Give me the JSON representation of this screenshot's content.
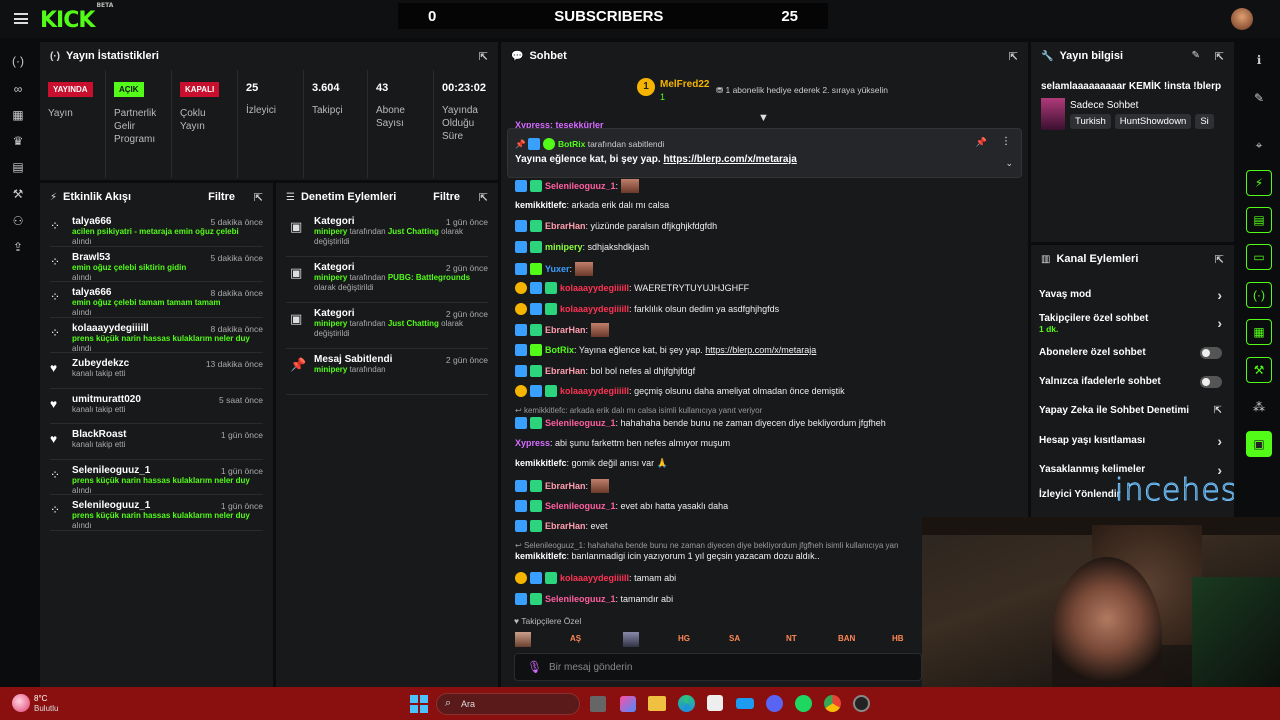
{
  "header": {
    "logo": "KICK",
    "beta": "BETA",
    "subs_left": "0",
    "subs_title": "SUBSCRIBERS",
    "subs_right": "25"
  },
  "stats": {
    "title": "Yayın İstatistikleri",
    "cols": [
      {
        "badge": "YAYINDA",
        "badge_color": "#c8102e",
        "label": "Yayın"
      },
      {
        "badge": "AÇIK",
        "badge_color": "#53fc18",
        "label": "Partnerlik Gelir Programı"
      },
      {
        "badge": "KAPALI",
        "badge_color": "#c8102e",
        "label": "Çoklu Yayın"
      },
      {
        "value": "25",
        "label": "İzleyici"
      },
      {
        "value": "3.604",
        "label": "Takipçi"
      },
      {
        "value": "43",
        "label": "Abone Sayısı"
      },
      {
        "value": "00:23:02",
        "label": "Yayında Olduğu Süre"
      }
    ]
  },
  "activity": {
    "title": "Etkinlik Akışı",
    "filter": "Filtre",
    "items": [
      {
        "icon": "gift-icon",
        "name": "talya666",
        "time": "5 dakika önce",
        "msg": "acilen psikiyatri - metaraja emin oğuz çelebi",
        "sub": "alındı"
      },
      {
        "icon": "gift-icon",
        "name": "Brawl53",
        "time": "5 dakika önce",
        "msg": "emin oğuz çelebi siktirin gidin",
        "sub": "alındı"
      },
      {
        "icon": "gift-icon",
        "name": "talya666",
        "time": "8 dakika önce",
        "msg": "emin oğuz çelebi tamam tamam tamam",
        "sub": "alındı"
      },
      {
        "icon": "gift-icon",
        "name": "kolaaayydegiiiill",
        "time": "8 dakika önce",
        "msg": "prens küçük narin hassas kulaklarım neler duy",
        "sub": "alındı"
      },
      {
        "icon": "heart-icon",
        "name": "Zubeydekzc",
        "time": "13 dakika önce",
        "msg": "",
        "sub": "kanalı takip etti"
      },
      {
        "icon": "heart-icon",
        "name": "umitmuratt020",
        "time": "5 saat önce",
        "msg": "",
        "sub": "kanalı takip etti"
      },
      {
        "icon": "heart-icon",
        "name": "BlackRoast",
        "time": "1 gün önce",
        "msg": "",
        "sub": "kanalı takip etti"
      },
      {
        "icon": "gift-icon",
        "name": "Selenileoguuz_1",
        "time": "1 gün önce",
        "msg": "prens küçük narin hassas kulaklarım neler duy",
        "sub": "alındı"
      },
      {
        "icon": "gift-icon",
        "name": "Selenileoguuz_1",
        "time": "1 gün önce",
        "msg": "prens küçük narin hassas kulaklarım neler duy",
        "sub": "alındı"
      }
    ]
  },
  "moderation": {
    "title": "Denetim Eylemleri",
    "filter": "Filtre",
    "items": [
      {
        "name": "Kategori",
        "time": "1 gün önce",
        "user": "minipery",
        "pre": " tarafından ",
        "val": "Just Chatting",
        "post": " olarak değiştirildi"
      },
      {
        "name": "Kategori",
        "time": "2 gün önce",
        "user": "minipery",
        "pre": " tarafından ",
        "val": "PUBG: Battlegrounds",
        "post": " olarak değiştirildi"
      },
      {
        "name": "Kategori",
        "time": "2 gün önce",
        "user": "minipery",
        "pre": " tarafından ",
        "val": "Just Chatting",
        "post": " olarak değiştirildi"
      },
      {
        "name": "Mesaj Sabitlendi",
        "time": "2 gün önce",
        "user": "minipery",
        "pre": " tarafından",
        "val": "",
        "post": ""
      }
    ]
  },
  "chat": {
    "title": "Sohbet",
    "gifter": "MelFred22",
    "gifter_count": "1",
    "gift_text": "1 abonelik hediye ederek 2. sıraya yükselin",
    "pinned_by": "BotRix",
    "pinned_suffix": "tarafından sabitlendi",
    "pinned_text": "Yayına eğlence kat, bi şey yap.",
    "pinned_link": "https://blerp.com/x/metaraja",
    "cut_top": "Xypress: teşekkürler",
    "messages": [
      {
        "user": "Selenileoguuz_1",
        "color": "#ff5fa2",
        "text": "",
        "emote": true
      },
      {
        "user": "kemikkitlefc",
        "color": "#ffffff",
        "text": "arkada erik dalı mı calsa"
      },
      {
        "user": "EbrarHan",
        "color": "#ff9eaf",
        "text": "yüzünde paralsın dfjkghjkfdgfdh"
      },
      {
        "user": "minipery",
        "color": "#8bff3a",
        "text": "sdhjakshdkjash"
      },
      {
        "user": "Yuxer",
        "color": "#3aa0ff",
        "text": "",
        "emote": true
      },
      {
        "user": "kolaaayydegiiiill",
        "color": "#ff3355",
        "text": "WAERETRYTUYUJHJGHFF"
      },
      {
        "user": "kolaaayydegiiiill",
        "color": "#ff3355",
        "text": "farklılık olsun dedim ya asdfghjhgfds"
      },
      {
        "user": "EbrarHan",
        "color": "#ff9eaf",
        "text": "",
        "emote": true
      },
      {
        "user": "BotRix",
        "color": "#53fc18",
        "text": "Yayına eğlence kat, bi şey yap. ",
        "link": "https://blerp.com/x/metaraja"
      },
      {
        "user": "EbrarHan",
        "color": "#ff9eaf",
        "text": "bol bol nefes al dhjfghjfdgf"
      },
      {
        "user": "kolaaayydegiiiill",
        "color": "#ff3355",
        "text": "geçmiş olsunu daha ameliyat olmadan önce demiştik"
      },
      {
        "reply": "kemikkitlefc: arkada erik dalı mı calsa isimli kullanıcıya yanıt veriyor"
      },
      {
        "user": "Selenileoguuz_1",
        "color": "#ff5fa2",
        "text": "hahahaha bende bunu ne zaman diyecen diye bekliyordum jfgfheh"
      },
      {
        "user": "Xypress",
        "color": "#d56bff",
        "text": "abi şunu farkettm ben nefes almıyor muşum"
      },
      {
        "user": "kemikkitlefc",
        "color": "#ffffff",
        "text": "gomik değil anısı var 🙏"
      },
      {
        "user": "EbrarHan",
        "color": "#ff9eaf",
        "text": "",
        "emote": true
      },
      {
        "user": "Selenileoguuz_1",
        "color": "#ff5fa2",
        "text": "evet abı hatta yasaklı daha"
      },
      {
        "user": "EbrarHan",
        "color": "#ff9eaf",
        "text": "evet"
      },
      {
        "reply": "Selenileoguuz_1: hahahaha bende bunu ne zaman diyecen diye bekliyordum jfgfheh isimli kullanıcıya yan"
      },
      {
        "user": "kemikkitlefc",
        "color": "#ffffff",
        "text": "banlanmadigi icin yazıyorum 1 yıl geçsin yazacam dozu aldık.."
      },
      {
        "user": "kolaaayydegiiiill",
        "color": "#ff3355",
        "text": "tamam abi"
      },
      {
        "user": "Selenileoguuz_1",
        "color": "#ff5fa2",
        "text": "tamamdır abi"
      }
    ],
    "follower_label": "Takipçilere Özel",
    "emotes": [
      "AŞ",
      "HG",
      "SA",
      "NT",
      "BAN",
      "HB"
    ],
    "input_placeholder": "Bir mesaj gönderin"
  },
  "info": {
    "title": "Yayın bilgisi",
    "stream_title": "selamlaaaaaaaaar KEMİK !insta !blerp",
    "category": "Sadece Sohbet",
    "tags": [
      "Turkish",
      "HuntShowdown",
      "Si"
    ]
  },
  "channel_actions": {
    "title": "Kanal Eylemleri",
    "rows": [
      {
        "label": "Yavaş mod",
        "kind": "chev"
      },
      {
        "label": "Takipçilere özel sohbet",
        "sub": "1 dk.",
        "kind": "chev"
      },
      {
        "label": "Abonelere özel sohbet",
        "kind": "toggle"
      },
      {
        "label": "Yalnızca ifadelerle sohbet",
        "kind": "toggle"
      },
      {
        "label": "Yapay Zeka ile Sohbet Denetimi",
        "kind": "ext"
      },
      {
        "label": "Hesap yaşı kısıtlaması",
        "kind": "chev"
      },
      {
        "label": "Yasaklanmış kelimeler",
        "kind": "chev"
      },
      {
        "label": "İzleyici Yönlendir",
        "kind": ""
      }
    ]
  },
  "watermark": "incehesap",
  "taskbar": {
    "temp": "8°C",
    "weather": "Bulutlu",
    "search": "Ara"
  }
}
